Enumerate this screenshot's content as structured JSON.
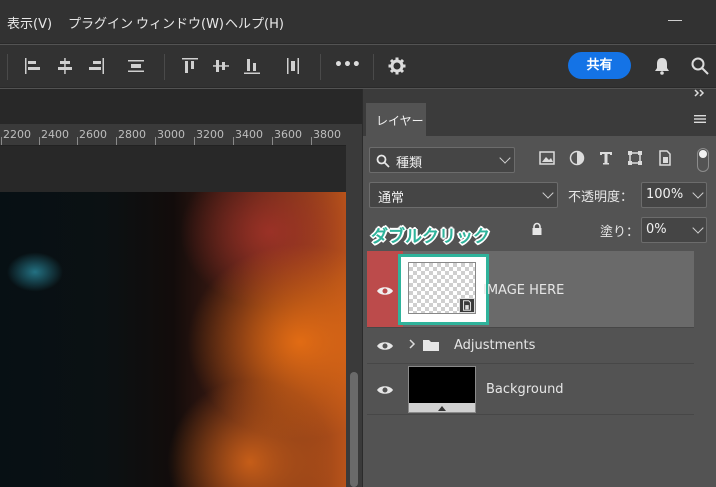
{
  "menu": {
    "items": [
      "表示(V)",
      "プラグイン",
      "ウィンドウ(W)",
      "ヘルプ(H)"
    ]
  },
  "toolbar": {
    "more_label": "•••",
    "share_label": "共有",
    "icons": [
      "align-left-icon",
      "align-center-h-icon",
      "align-right-icon",
      "distribute-h-icon",
      "align-top-icon",
      "align-center-v-icon",
      "align-bottom-icon",
      "distribute-v-icon",
      "gear-icon",
      "bell-icon",
      "search-icon"
    ]
  },
  "ruler": {
    "labels": [
      "2200",
      "2400",
      "2600",
      "2800",
      "3000",
      "3200",
      "3400",
      "3600",
      "3800"
    ]
  },
  "layers_panel": {
    "tab_label": "レイヤー",
    "filter_kind": "種類",
    "blend_mode": "通常",
    "opacity_label": "不透明度：",
    "opacity_value": "100%",
    "fill_label": "塗り：",
    "fill_value": "0%",
    "annotation": "ダブルクリック",
    "layers": [
      {
        "name": "IMAGE HERE",
        "selected": true,
        "type": "smart-object"
      },
      {
        "name": "Adjustments",
        "selected": false,
        "type": "group"
      },
      {
        "name": "Background",
        "selected": false,
        "type": "pixel"
      }
    ]
  },
  "colors": {
    "accent": "#1473e6",
    "annotation": "#2fb39b",
    "selected_layer_visibility": "#bc4b4b"
  }
}
